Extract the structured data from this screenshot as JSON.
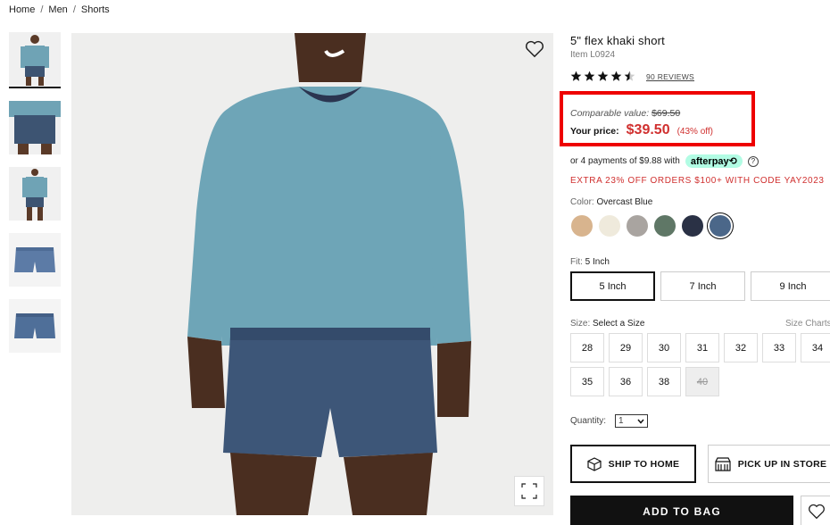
{
  "breadcrumb": {
    "home": "Home",
    "men": "Men",
    "shorts": "Shorts",
    "separator": "/"
  },
  "product": {
    "title": "5\" flex khaki short",
    "item_number": "Item L0924",
    "rating": 4.5,
    "reviews_label": "90 REVIEWS"
  },
  "price": {
    "comparable_label": "Comparable value:",
    "comparable_value": "$69.50",
    "your_price_label": "Your price:",
    "your_price_value": "$39.50",
    "discount": "(43% off)"
  },
  "afterpay": {
    "text": "or 4 payments of $9.88 with",
    "badge": "afterpay⟲",
    "help": "?"
  },
  "promo": "EXTRA 23% OFF ORDERS $100+ WITH CODE YAY2023",
  "color": {
    "label": "Color:",
    "selected": "Overcast Blue",
    "swatches": [
      "#d8b48e",
      "#efeadc",
      "#a9a4a0",
      "#5f7766",
      "#2a3145",
      "#4b6789"
    ]
  },
  "fit": {
    "label": "Fit:",
    "selected": "5 Inch",
    "options": [
      "5 Inch",
      "7 Inch",
      "9 Inch"
    ]
  },
  "size": {
    "label": "Size:",
    "selected": "Select a Size",
    "chart_link": "Size Charts",
    "options": [
      "28",
      "29",
      "30",
      "31",
      "32",
      "33",
      "34",
      "35",
      "36",
      "38",
      "40"
    ],
    "unavailable": [
      "40"
    ]
  },
  "quantity": {
    "label": "Quantity:",
    "value": "1"
  },
  "shipping": {
    "ship_home": "SHIP TO HOME",
    "pickup": "PICK UP IN STORE"
  },
  "actions": {
    "add_to_bag": "ADD TO BAG"
  },
  "colors": {
    "sale_red": "#d0302f",
    "highlight_box": "#e00000",
    "afterpay_mint": "#b2fce4"
  }
}
